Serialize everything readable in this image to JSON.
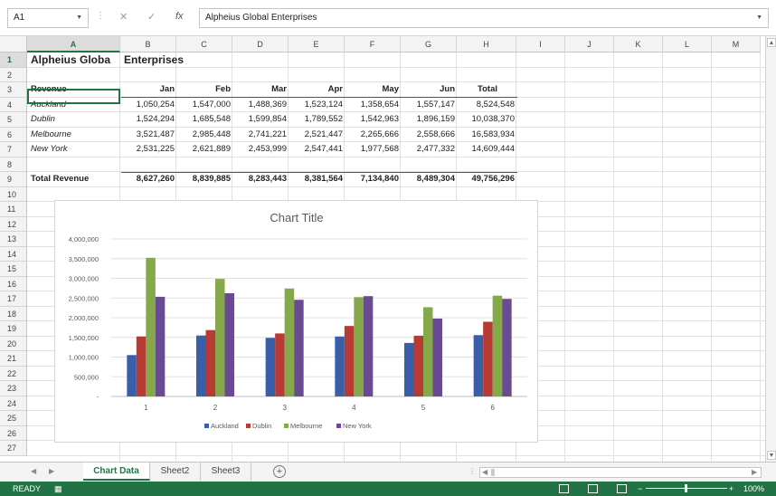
{
  "formula_bar": {
    "name_box": "A1",
    "cancel_glyph": "✕",
    "enter_glyph": "✓",
    "fx_glyph": "fx",
    "content": "Alpheius Global Enterprises"
  },
  "columns": [
    "A",
    "B",
    "C",
    "D",
    "E",
    "F",
    "G",
    "H",
    "I",
    "J",
    "K",
    "L",
    "M"
  ],
  "rows": [
    "1",
    "2",
    "3",
    "4",
    "5",
    "6",
    "7",
    "8",
    "9",
    "10",
    "11",
    "12",
    "13",
    "14",
    "15",
    "16",
    "17",
    "18",
    "19",
    "20",
    "21",
    "22",
    "23",
    "24",
    "25",
    "26",
    "27"
  ],
  "sheet": {
    "title_a1": "Alpheius Globa",
    "title_b1": "Enterprises",
    "header": {
      "label": "Revenue",
      "months": [
        "Jan",
        "Feb",
        "Mar",
        "Apr",
        "May",
        "Jun"
      ],
      "total": "Total"
    },
    "data_rows": [
      {
        "city": "Auckland",
        "values": [
          "1,050,254",
          "1,547,000",
          "1,488,369",
          "1,523,124",
          "1,358,654",
          "1,557,147"
        ],
        "total": "8,524,548"
      },
      {
        "city": "Dublin",
        "values": [
          "1,524,294",
          "1,685,548",
          "1,599,854",
          "1,789,552",
          "1,542,963",
          "1,896,159"
        ],
        "total": "10,038,370"
      },
      {
        "city": "Melbourne",
        "values": [
          "3,521,487",
          "2,985,448",
          "2,741,221",
          "2,521,447",
          "2,265,666",
          "2,558,666"
        ],
        "total": "16,583,934"
      },
      {
        "city": "New York",
        "values": [
          "2,531,225",
          "2,621,889",
          "2,453,999",
          "2,547,441",
          "1,977,568",
          "2,477,332"
        ],
        "total": "14,609,444"
      }
    ],
    "total_row": {
      "label": "Total Revenue",
      "values": [
        "8,627,260",
        "8,839,885",
        "8,283,443",
        "8,381,564",
        "7,134,840",
        "8,489,304"
      ],
      "total": "49,756,296"
    }
  },
  "chart_data": {
    "type": "bar",
    "title": "Chart Title",
    "xlabel": "",
    "ylabel": "",
    "categories": [
      "1",
      "2",
      "3",
      "4",
      "5",
      "6"
    ],
    "ylim": [
      0,
      4000000
    ],
    "yticks": [
      "-",
      "500,000",
      "1,000,000",
      "1,500,000",
      "2,000,000",
      "2,500,000",
      "3,000,000",
      "3,500,000",
      "4,000,000"
    ],
    "grid": true,
    "legend_position": "bottom",
    "series": [
      {
        "name": "Auckland",
        "color": "#3a5ea8",
        "values": [
          1050254,
          1547000,
          1488369,
          1523124,
          1358654,
          1557147
        ]
      },
      {
        "name": "Dublin",
        "color": "#b83a35",
        "values": [
          1524294,
          1685548,
          1599854,
          1789552,
          1542963,
          1896159
        ]
      },
      {
        "name": "Melbourne",
        "color": "#85a84a",
        "values": [
          3521487,
          2985448,
          2741221,
          2521447,
          2265666,
          2558666
        ]
      },
      {
        "name": "New York",
        "color": "#6a4a92",
        "values": [
          2531225,
          2621889,
          2453999,
          2547441,
          1977568,
          2477332
        ]
      }
    ]
  },
  "tabs": {
    "sheets": [
      "Chart Data",
      "Sheet2",
      "Sheet3"
    ],
    "active": "Chart Data",
    "add_glyph": "+"
  },
  "status": {
    "ready": "READY",
    "zoom": "100%",
    "zoom_minus": "−",
    "zoom_plus": "+"
  },
  "colors": {
    "excel_green": "#217346"
  }
}
